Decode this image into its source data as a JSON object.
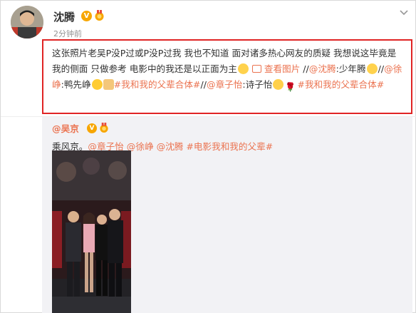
{
  "post": {
    "author": "沈腾",
    "timestamp": "2分钟前",
    "text": {
      "part1": "这张照片老吴P没P过或P没P过我 我也不知道 面对诸多热心网友的质疑 我想说这毕竟是我的侧面 只做参考 电影中的我还是以正面为主",
      "view_images": "查看图片",
      "sep1": " //",
      "mention1": "@沈腾",
      "colon1": ":",
      "part2": "少年腾",
      "sep2": "//",
      "mention2": "@徐峥",
      "colon2": ":鸭先峥",
      "hashtag1": "#我和我的父辈合体#",
      "sep3": "//",
      "mention3": "@章子怡",
      "colon3": ":诗子怡",
      "hashtag2": "#我和我的父辈合体#"
    }
  },
  "repost": {
    "author": "@吴京",
    "text_prefix": "乘风京。",
    "mention_a": "@章子怡",
    "mention_b": "@徐峥",
    "mention_c": "@沈腾",
    "hashtag": "#电影我和我的父辈#"
  },
  "badges": {
    "verified": "V"
  },
  "icons": {
    "chevron": "chevron-down-icon",
    "view_images": "image-icon"
  },
  "colors": {
    "link": "#eb7350",
    "highlight_border": "#e02424",
    "verified_badge": "#f7a600",
    "repost_bg": "#f2f2f5"
  }
}
